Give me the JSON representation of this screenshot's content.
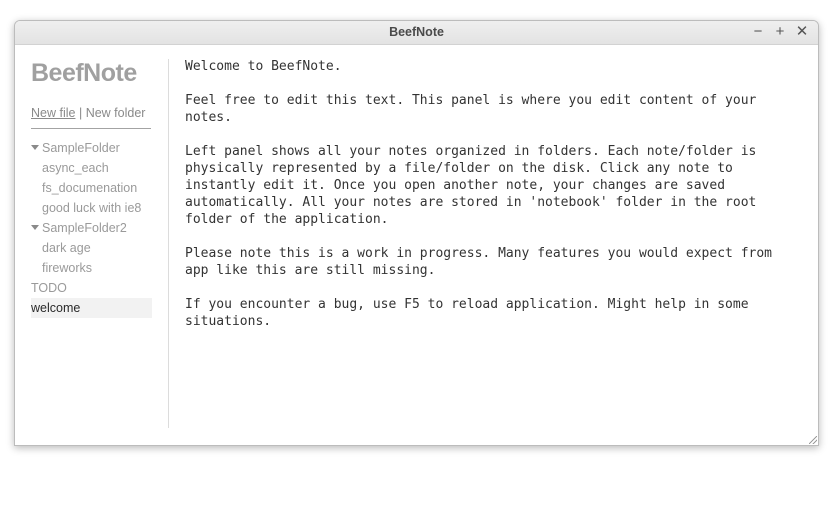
{
  "window": {
    "title": "BeefNote",
    "controls": {
      "minimize_icon": "minimize-icon",
      "maximize_icon": "maximize-icon",
      "close_icon": "close-icon",
      "minimize_glyph": "−",
      "maximize_glyph": "+",
      "close_glyph": "✕"
    }
  },
  "sidebar": {
    "app_title": "BeefNote",
    "new_file_label": "New file",
    "separator": "|",
    "new_folder_label": "New folder",
    "tree": [
      {
        "label": "SampleFolder",
        "expanded": true,
        "children": [
          "async_each",
          "fs_documenation",
          "good luck with ie8"
        ]
      },
      {
        "label": "SampleFolder2",
        "expanded": true,
        "children": [
          "dark age",
          "fireworks"
        ]
      },
      {
        "label": "TODO"
      },
      {
        "label": "welcome",
        "selected": true
      }
    ]
  },
  "editor": {
    "content": "Welcome to BeefNote.\n\nFeel free to edit this text. This panel is where you edit content of your\nnotes.\n\nLeft panel shows all your notes organized in folders. Each note/folder is\nphysically represented by a file/folder on the disk. Click any note to\ninstantly edit it. Once you open another note, your changes are saved\nautomatically. All your notes are stored in 'notebook' folder in the root\nfolder of the application.\n\nPlease note this is a work in progress. Many features you would expect from\napp like this are still missing.\n\nIf you encounter a bug, use F5 to reload application. Might help in some\nsituations."
  },
  "colors": {
    "app_title": "#a0a0a0",
    "sidebar_text": "#9a9a9a",
    "selected_background": "#f2f2f2",
    "editor_text": "#333333"
  }
}
